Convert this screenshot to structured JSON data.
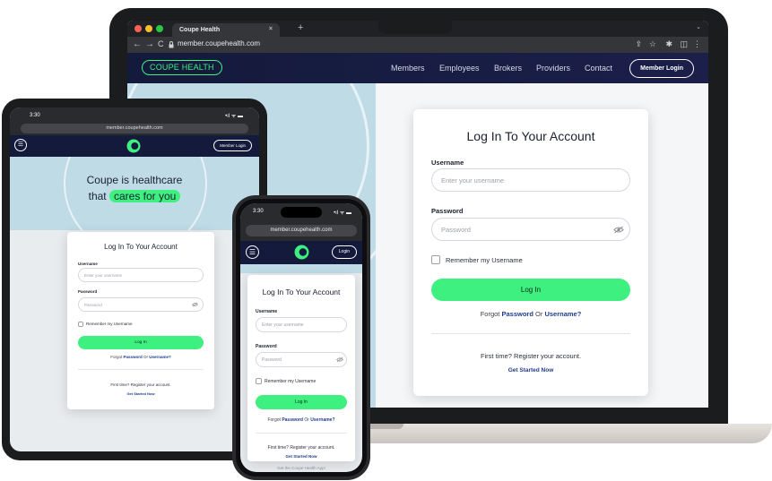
{
  "laptop": {
    "browser": {
      "tab_title": "Coupe Health",
      "tab_close": "×",
      "new_tab": "+",
      "tab_menu": "⌄",
      "back": "←",
      "forward": "→",
      "reload": "C",
      "url": "member.coupehealth.com",
      "tools": [
        "⇪",
        "☆",
        "✱",
        "◫",
        "⋮"
      ]
    },
    "nav": {
      "logo": "COUPE HEALTH",
      "links": [
        "Members",
        "Employees",
        "Brokers",
        "Providers",
        "Contact"
      ],
      "member_login": "Member Login"
    },
    "login": {
      "title": "Log In To Your Account",
      "username_label": "Username",
      "username_placeholder": "Enter your username",
      "password_label": "Password",
      "password_placeholder": "Password",
      "remember": "Remember my Username",
      "login_button": "Log In",
      "forgot_prefix": "Forgot",
      "forgot_password": "Password",
      "forgot_or": "Or",
      "forgot_username": "Username?",
      "first_time": "First time? Register your account.",
      "get_started": "Get Started Now"
    }
  },
  "tablet": {
    "time": "3:30",
    "signal": "•ıl ᯤ ▬",
    "url": "member.coupehealth.com",
    "menu_icon": "☰",
    "member_login": "Member Login",
    "hero_line1": "Coupe is healthcare",
    "hero_that": "that",
    "hero_highlight": "cares for you",
    "login": {
      "title": "Log In To Your Account",
      "username_label": "Username",
      "username_placeholder": "Enter your username",
      "password_label": "Password",
      "password_placeholder": "Password",
      "remember": "Remember my Username",
      "login_button": "Log In",
      "forgot_prefix": "Forgot",
      "forgot_password": "Password",
      "forgot_or": "Or",
      "forgot_username": "Username?",
      "first_time": "First time? Register your account.",
      "get_started": "Get Started Now"
    }
  },
  "phone": {
    "time": "3:30",
    "signal": "•ıl ᯤ ▬",
    "url": "member.coupehealth.com",
    "menu_icon": "☰",
    "login_button_nav": "Login",
    "login": {
      "title": "Log In To Your Account",
      "username_label": "Username",
      "username_placeholder": "Enter your username",
      "password_label": "Password",
      "password_placeholder": "Password",
      "remember": "Remember my Username",
      "login_button": "Log In",
      "forgot_prefix": "Forgot",
      "forgot_password": "Password",
      "forgot_or": "Or",
      "forgot_username": "Username?",
      "first_time": "First time? Register your account.",
      "get_started": "Get Started Now",
      "app_promo": "Get the Coupe Health App!"
    }
  },
  "colors": {
    "brand_navy": "#141a3b",
    "brand_green": "#3df07f",
    "link_blue": "#1f3c8f",
    "hero_blue": "#bfdbe6"
  }
}
